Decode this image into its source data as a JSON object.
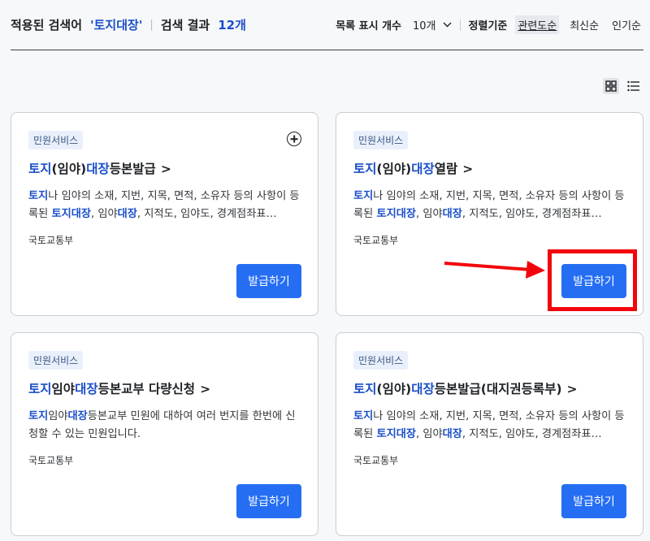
{
  "header": {
    "applied_label": "적용된 검색어",
    "keyword": "'토지대장'",
    "result_label": "검색 결과",
    "result_count": "12개",
    "list_count_label": "목록 표시 개수",
    "list_count_value": "10개",
    "sort_label": "정렬기준",
    "sort_options": [
      "관련도순",
      "최신순",
      "인기순"
    ],
    "sort_active": "관련도순"
  },
  "view_toggle": {
    "active": "grid",
    "icons": [
      "grid-icon",
      "list-icon"
    ]
  },
  "cards": [
    {
      "badge": "민원서비스",
      "title_parts": [
        "토지",
        "(임야)",
        "대장",
        "등본발급"
      ],
      "desc_parts": [
        "토지",
        "나 임야의 소재, 지번, 지목, 면적, 소유자 등의 사항이 등록된 ",
        "토지대장",
        ", 임야",
        "대장",
        ", 지적도, 임야도, 경계점좌표…"
      ],
      "org": "국토교통부",
      "button": "발급하기",
      "has_plus": true
    },
    {
      "badge": "민원서비스",
      "title_parts": [
        "토지",
        "(임야)",
        "대장",
        "열람"
      ],
      "desc_parts": [
        "토지",
        "나 임야의 소재, 지번, 지목, 면적, 소유자 등의 사항이 등록된 ",
        "토지대장",
        ", 임야",
        "대장",
        ", 지적도, 임야도, 경계점좌표…"
      ],
      "org": "국토교통부",
      "button": "발급하기",
      "has_plus": false
    },
    {
      "badge": "민원서비스",
      "title_parts": [
        "토지",
        "임야",
        "대장",
        "등본교부 다량신청"
      ],
      "desc_parts": [
        "토지",
        "임야",
        "대장",
        "등본교부 민원에 대하여 여러 번지를 한번에 신청할 수 있는 민원입니다."
      ],
      "org": "국토교통부",
      "button": "발급하기",
      "has_plus": false
    },
    {
      "badge": "민원서비스",
      "title_parts": [
        "토지",
        "(임야)",
        "대장",
        "등본발급(대지권등록부)"
      ],
      "desc_parts": [
        "토지",
        "나 임야의 소재, 지번, 지목, 면적, 소유자 등의 사항이 등록된 ",
        "토지대장",
        ", 임야",
        "대장",
        ", 지적도, 임야도, 경계점좌표…"
      ],
      "org": "국토교통부",
      "button": "발급하기",
      "has_plus": false
    }
  ],
  "annotation": {
    "color": "#f2060b",
    "target": "card-2-issue-button"
  },
  "colors": {
    "accent": "#256ef4",
    "highlight": "#1a4fc9",
    "annotation": "#f2060b"
  }
}
